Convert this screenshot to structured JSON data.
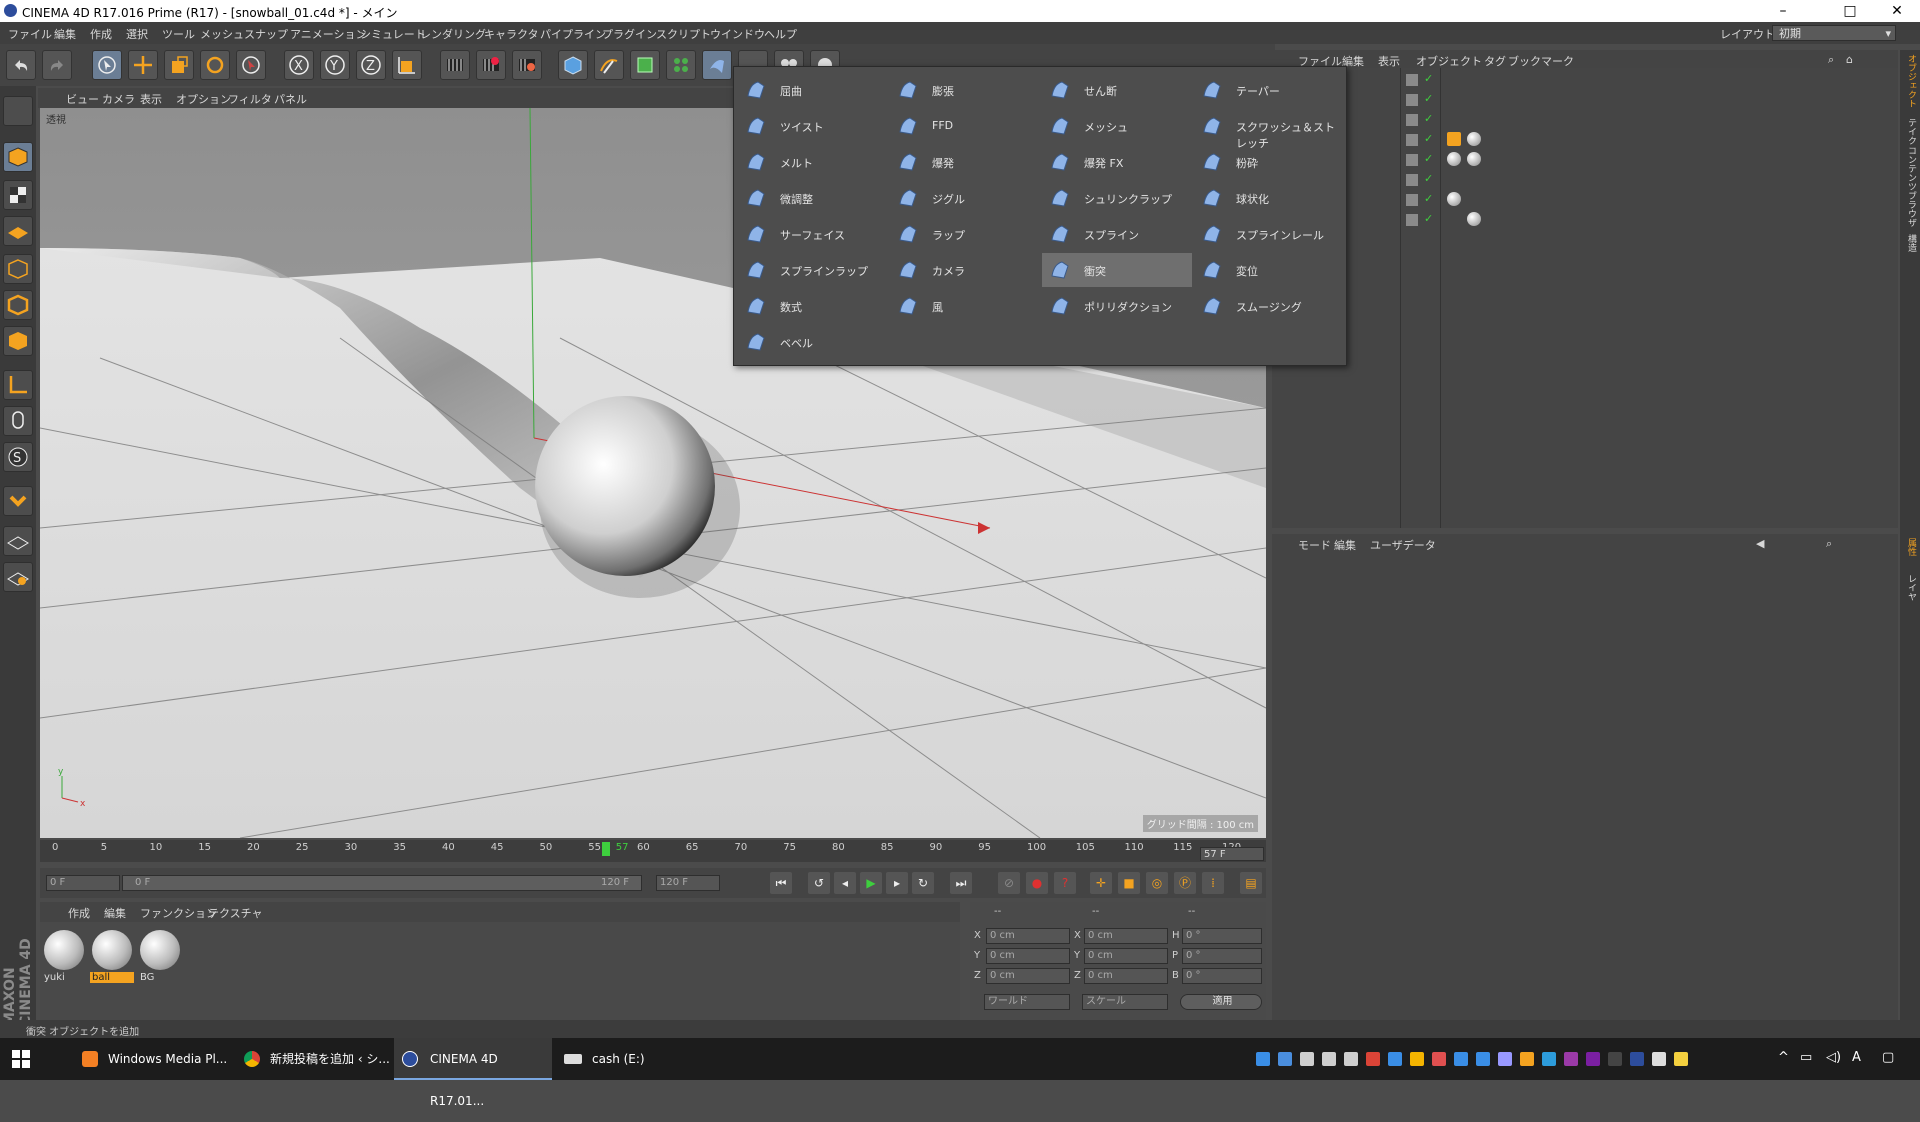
{
  "window": {
    "title": "CINEMA 4D R17.016 Prime (R17) - [snowball_01.c4d *] - メイン",
    "controls": [
      "–",
      "□",
      "✕"
    ]
  },
  "menubar": {
    "items": [
      "ファイル",
      "編集",
      "作成",
      "選択",
      "ツール",
      "メッシュ",
      "スナップ",
      "アニメーション",
      "シミュレート",
      "レンダリング",
      "キャラクタ",
      "パイプライン",
      "プラグイン",
      "スクリプト",
      "ウインドウ",
      "ヘルプ"
    ],
    "layout_label": "レイアウト:",
    "layout_value": "初期"
  },
  "viewport": {
    "menu": [
      "ビュー",
      "カメラ",
      "表示",
      "オプション",
      "フィルタ",
      "パネル"
    ],
    "camera_label": "透視",
    "grid_label": "グリッド間隔 : 100 cm"
  },
  "deformer_menu": {
    "columns": [
      [
        "屈曲",
        "ツイスト",
        "メルト",
        "微調整",
        "サーフェイス",
        "スプラインラップ",
        "数式",
        "ベベル"
      ],
      [
        "膨張",
        "FFD",
        "爆発",
        "ジグル",
        "ラップ",
        "カメラ",
        "風"
      ],
      [
        "せん断",
        "メッシュ",
        "爆発 FX",
        "シュリンクラップ",
        "スプライン",
        "衝突",
        "ポリリダクション"
      ],
      [
        "テーパー",
        "スクワッシュ＆ストレッチ",
        "粉砕",
        "球状化",
        "スプラインレール",
        "変位",
        "スムージング"
      ]
    ],
    "highlighted": "衝突"
  },
  "object_manager": {
    "menu": [
      "ファイル",
      "編集",
      "表示",
      "オブジェクト",
      "タグ",
      "ブックマーク"
    ]
  },
  "attribute_manager": {
    "menu": [
      "モード",
      "編集",
      "ユーザデータ"
    ]
  },
  "right_tabs": [
    "オブジェクト",
    "テイク",
    "コンテンツブラウザ",
    "構造",
    "属性",
    "レイヤ"
  ],
  "timeline": {
    "ticks": [
      "0",
      "5",
      "10",
      "15",
      "20",
      "25",
      "30",
      "35",
      "40",
      "45",
      "50",
      "55",
      "57",
      "60",
      "65",
      "70",
      "75",
      "80",
      "85",
      "90",
      "95",
      "100",
      "105",
      "110",
      "115",
      "120"
    ],
    "current_frame": "57 F",
    "start_field": "0 F",
    "range_start": "0 F",
    "range_end": "120 F",
    "end_field": "120 F",
    "current_value": 57,
    "max_value": 120
  },
  "material_manager": {
    "menu": [
      "作成",
      "編集",
      "ファンクション",
      "テクスチャ"
    ],
    "materials": [
      {
        "name": "yuki",
        "selected": false
      },
      {
        "name": "ball",
        "selected": true
      },
      {
        "name": "BG",
        "selected": false
      }
    ]
  },
  "coordinates": {
    "header": [
      "--",
      "--",
      "--"
    ],
    "rows": [
      {
        "a": "X",
        "av": "0 cm",
        "b": "X",
        "bv": "0 cm",
        "c": "H",
        "cv": "0 °"
      },
      {
        "a": "Y",
        "av": "0 cm",
        "b": "Y",
        "bv": "0 cm",
        "c": "P",
        "cv": "0 °"
      },
      {
        "a": "Z",
        "av": "0 cm",
        "b": "Z",
        "bv": "0 cm",
        "c": "B",
        "cv": "0 °"
      }
    ],
    "world": "ワールド",
    "scale": "スケール",
    "apply": "適用"
  },
  "side_logo": "MAXON CINEMA 4D",
  "status": "衝突 オブジェクトを追加",
  "taskbar": {
    "tasks": [
      "Windows Media Pl...",
      "新規投稿を追加 ‹ シ...",
      "CINEMA 4D R17.01...",
      "cash (E:)"
    ]
  },
  "colors": {
    "accent_orange": "#f4a320",
    "selection_blue": "#6b7e95",
    "panel_bg": "#454545"
  }
}
